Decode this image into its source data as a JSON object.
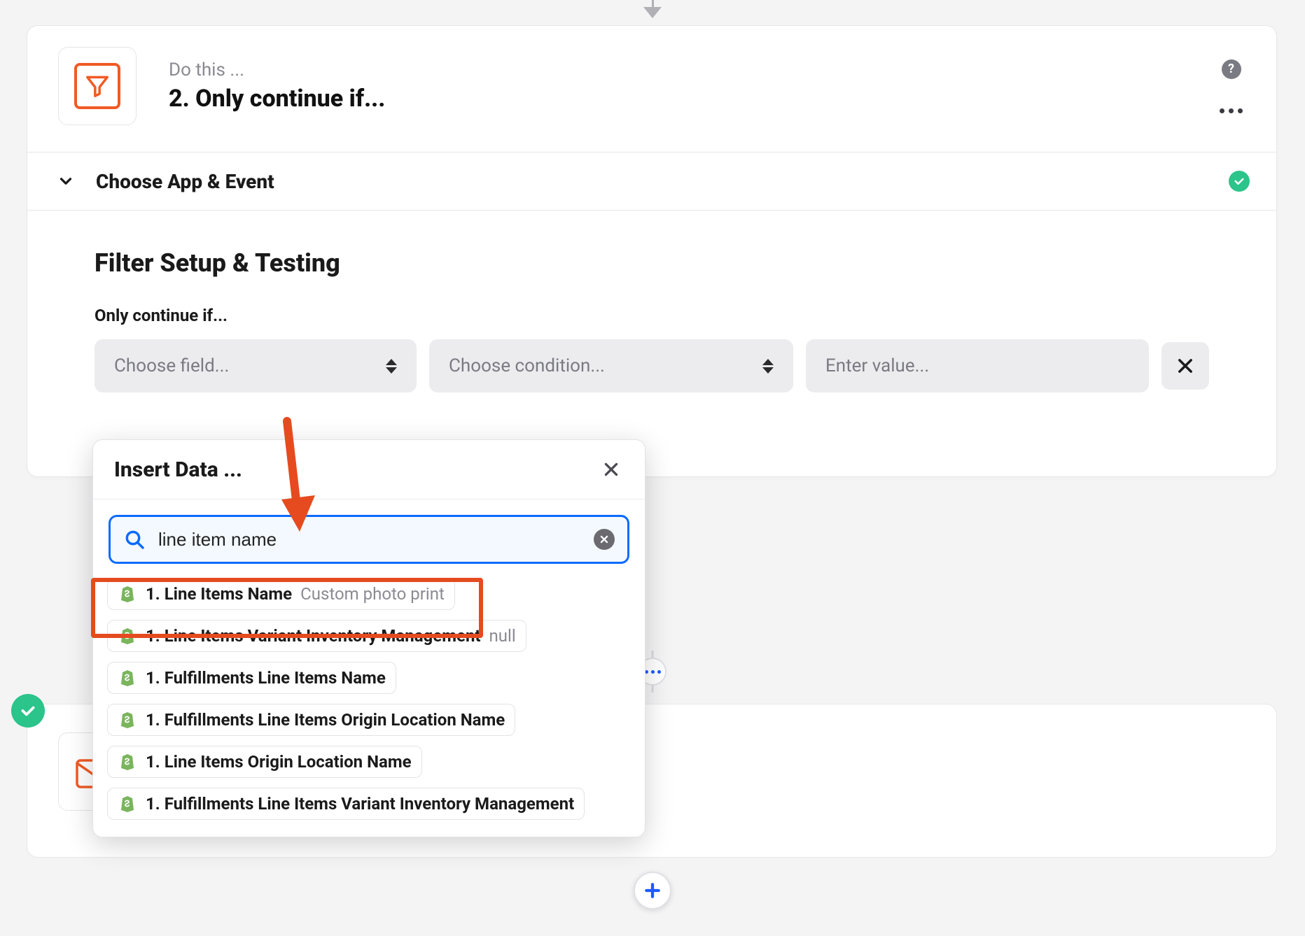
{
  "step": {
    "kicker": "Do this ...",
    "title": "2. Only continue if..."
  },
  "sections": {
    "choose_app_event": "Choose App & Event",
    "filter_setup_testing": "Filter Setup & Testing",
    "only_continue_if": "Only continue if..."
  },
  "fields": {
    "choose_field_placeholder": "Choose field...",
    "choose_condition_placeholder": "Choose condition...",
    "enter_value_placeholder": "Enter value..."
  },
  "popover": {
    "title": "Insert Data ...",
    "search_value": "line item name"
  },
  "results": [
    {
      "label": "1. Line Items Name",
      "sub": "Custom photo print"
    },
    {
      "label": "1. Line Items Variant Inventory Management",
      "sub": "null"
    },
    {
      "label": "1. Fulfillments Line Items Name",
      "sub": ""
    },
    {
      "label": "1. Fulfillments Line Items Origin Location Name",
      "sub": ""
    },
    {
      "label": "1. Line Items Origin Location Name",
      "sub": ""
    },
    {
      "label": "1. Fulfillments Line Items Variant Inventory Management",
      "sub": ""
    }
  ],
  "icons": {
    "help": "?",
    "close": "✕",
    "plus": "+"
  }
}
